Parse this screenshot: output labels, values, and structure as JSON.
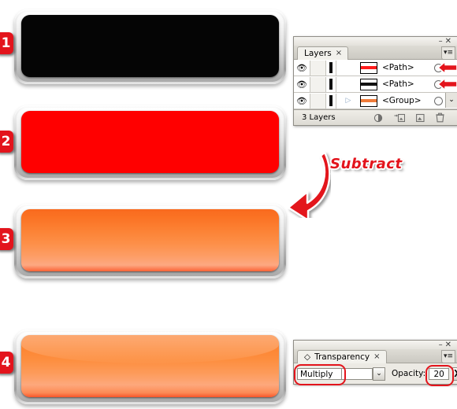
{
  "steps": [
    {
      "badge": "1",
      "name": "black-button",
      "style": "black"
    },
    {
      "badge": "2",
      "name": "red-button",
      "style": "red"
    },
    {
      "badge": "3",
      "name": "orange-button",
      "style": "orange"
    },
    {
      "badge": "4",
      "name": "orange-gloss-button",
      "style": "orange-gloss"
    }
  ],
  "annotation": {
    "subtract_label": "Subtract",
    "arrow_icon": "curved-arrow-down-left-icon",
    "color": "#e3141c"
  },
  "layers_panel": {
    "tab_label": "Layers",
    "tab_close": "×",
    "minimize_glyph": "–",
    "close_glyph": "✕",
    "flyout_glyph": "▾≡",
    "scroll_glyph": "⌄",
    "rows": [
      {
        "visibility_icon": "eye-icon",
        "lock_icon": "",
        "thumb_colors": [
          "#ffffff",
          "#ff1d1d",
          "#ffffff"
        ],
        "name": "<Path>",
        "target": "target-circle",
        "has_disclosure": false,
        "arrow_marker": true
      },
      {
        "visibility_icon": "eye-icon",
        "lock_icon": "",
        "thumb_colors": [
          "#ffffff",
          "#111111",
          "#ffffff"
        ],
        "name": "<Path>",
        "target": "target-circle",
        "has_disclosure": false,
        "arrow_marker": true
      },
      {
        "visibility_icon": "eye-icon",
        "lock_icon": "",
        "thumb_colors": [
          "#ffffff",
          "#f07c3a",
          "#ffffff"
        ],
        "name": "<Group>",
        "target": "target-circle",
        "has_disclosure": true,
        "disclosure_glyph": "▷",
        "arrow_marker": false
      }
    ],
    "footer": {
      "count_label": "3 Layers",
      "icons": [
        "make-clipping-mask-icon",
        "create-sublayer-icon",
        "create-new-layer-icon",
        "delete-layer-icon"
      ]
    }
  },
  "transparency_panel": {
    "menu_glyph": "◇",
    "tab_label": "Transparency",
    "tab_close": "×",
    "minimize_glyph": "–",
    "close_glyph": "✕",
    "flyout_glyph": "▾≡",
    "blend_mode": "Multiply",
    "blend_mode_chevron": "⌄",
    "opacity_label": "Opacity:",
    "opacity_value": "20",
    "opacity_stepper": "❯",
    "percent_symbol": "%",
    "highlight_color": "#e3141c"
  }
}
